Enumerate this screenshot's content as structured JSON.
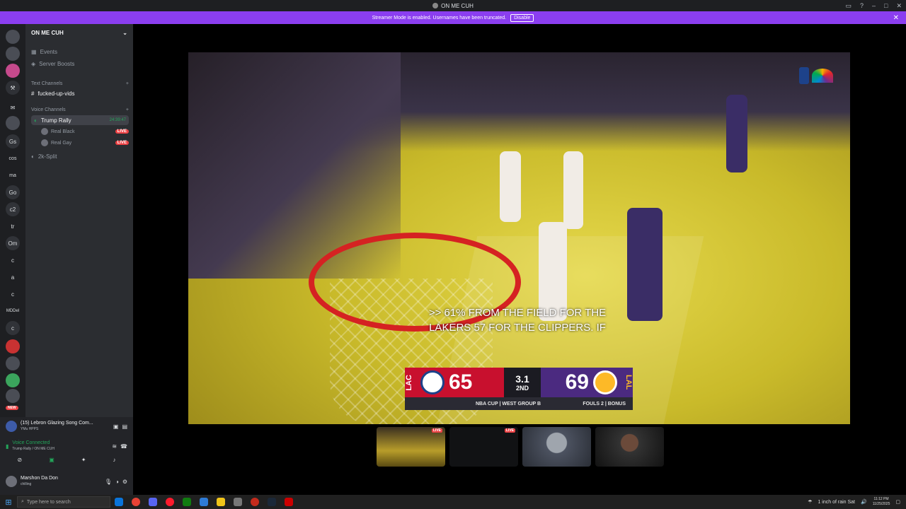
{
  "window": {
    "title": "ON ME CUH"
  },
  "banner": {
    "text": "Streamer Mode is enabled. Usernames have been truncated.",
    "button": "Disable"
  },
  "server_rail": [
    "Gs",
    "cos",
    "ma",
    "Go",
    "c2",
    "tr",
    "Om",
    "c",
    "a",
    "c",
    "MDDel",
    "c"
  ],
  "rail_badge": "NEW",
  "server": {
    "name": "ON ME CUH",
    "events": "Events",
    "boosts": "Server Boosts",
    "text_category": "Text Channels",
    "text_channels": [
      "fucked-up-vids"
    ],
    "voice_category": "Voice Channels",
    "voice_channel": "Trump Rally",
    "voice_timer": "24:39:47",
    "members": [
      {
        "name": "Real Black",
        "badge": "LIVE"
      },
      {
        "name": "Real Gay",
        "badge": "LIVE"
      }
    ],
    "other_voice": "2k-Split"
  },
  "activity": {
    "title": "(15) Lebron Glazing Song Com...",
    "sub": "YMu HPPS"
  },
  "voice": {
    "status": "Voice Connected",
    "path": "Trump Rally / ON ME CUH"
  },
  "user": {
    "name": "Marshon Da Don",
    "status": "chilling"
  },
  "stream": {
    "caption_line1": ">> 61% FROM THE FIELD FOR THE",
    "caption_line2": "LAKERS 57 FOR THE CLIPPERS. IF",
    "home_abbr": "LAC",
    "home_score": "65",
    "away_abbr": "LAL",
    "away_score": "69",
    "clock": "3.1",
    "period": "2ND",
    "event": "NBA CUP | WEST GROUP B",
    "fouls": "FOULS 2 | BONUS",
    "thumb_live": "LIVE"
  },
  "taskbar": {
    "search_placeholder": "Type here to search",
    "weather": "1 inch of rain Sat",
    "time": "11:12 PM",
    "date": "11/25/2025"
  }
}
